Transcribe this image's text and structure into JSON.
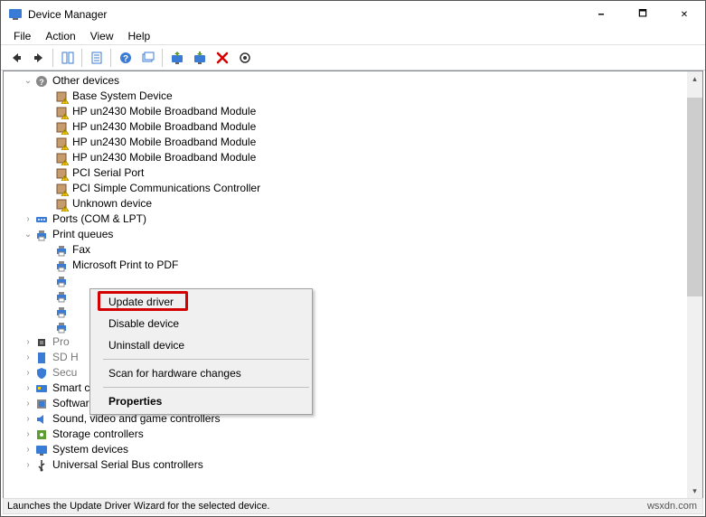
{
  "window": {
    "title": "Device Manager"
  },
  "menubar": [
    "File",
    "Action",
    "View",
    "Help"
  ],
  "tree": {
    "other_devices": {
      "label": "Other devices",
      "children": [
        "Base System Device",
        "HP un2430 Mobile Broadband Module",
        "HP un2430 Mobile Broadband Module",
        "HP un2430 Mobile Broadband Module",
        "HP un2430 Mobile Broadband Module",
        "PCI Serial Port",
        "PCI Simple Communications Controller",
        "Unknown device"
      ]
    },
    "ports": {
      "label": "Ports (COM & LPT)"
    },
    "print_queues": {
      "label": "Print queues",
      "children": [
        "Fax",
        "Microsoft Print to PDF"
      ]
    },
    "processors": {
      "label": "Processors"
    },
    "sd_host": {
      "label": "SD Host Adapters"
    },
    "security": {
      "label": "Security devices"
    },
    "smart_card": {
      "label": "Smart card readers"
    },
    "software": {
      "label": "Software devices"
    },
    "sound": {
      "label": "Sound, video and game controllers"
    },
    "storage": {
      "label": "Storage controllers"
    },
    "system": {
      "label": "System devices"
    },
    "usb": {
      "label": "Universal Serial Bus controllers"
    }
  },
  "context_menu": {
    "update": "Update driver",
    "disable": "Disable device",
    "uninstall": "Uninstall device",
    "scan": "Scan for hardware changes",
    "properties": "Properties"
  },
  "statusbar": {
    "text": "Launches the Update Driver Wizard for the selected device.",
    "brand": "wsxdn.com"
  }
}
